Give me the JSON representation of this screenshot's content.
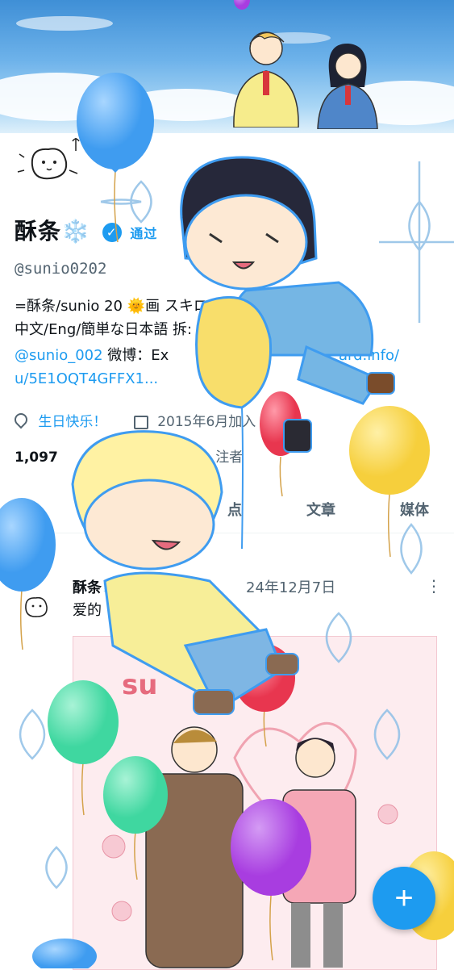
{
  "profile": {
    "display_name": "酥条❄️",
    "verified_badge_text": "通过",
    "handle": "@sunio0202",
    "bio_line1": "=酥条/sunio 20  🌞画           スキロー",
    "bio_line2": "中文/Eng/簡単な日本語              拆:",
    "bio_link1": "@sunio_002",
    "bio_mid": " 微博：Ex",
    "bio_link2": "ard.info/",
    "bio_link3": "u/5E1OQT4GFFX1...",
    "location": "生日快乐！",
    "joined": "2015年6月加入",
    "following_count": "1,097",
    "followers_label": "注者"
  },
  "tabs": {
    "highlights": "点",
    "articles": "文章",
    "media": "媒体"
  },
  "post": {
    "author": "酥条❄️",
    "date": "24年12月7日",
    "text": "爱的",
    "more": "⋮",
    "image_caption": "su"
  },
  "fab": {
    "label": "+"
  },
  "colors": {
    "accent": "#1d9bf0",
    "balloon_blue": "#3f9cf0",
    "balloon_yellow": "#f6cf3c",
    "balloon_red": "#e8364f",
    "balloon_green": "#3fd7a0",
    "balloon_purple": "#a83de0"
  }
}
